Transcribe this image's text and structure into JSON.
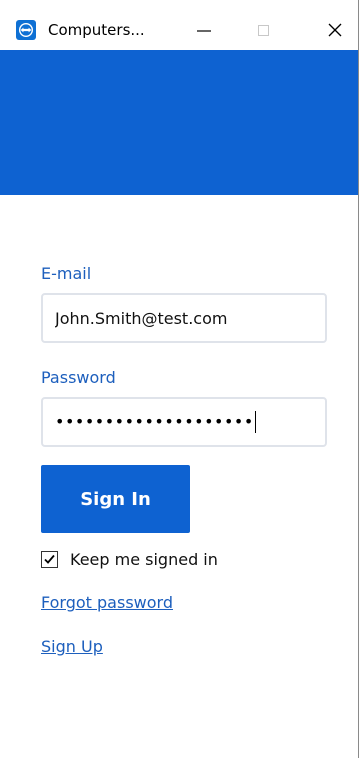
{
  "window": {
    "title": "Computers...",
    "controls": {
      "minimize_icon": "minimize-icon",
      "maximize_icon": "maximize-icon",
      "close_icon": "close-icon"
    }
  },
  "form": {
    "email_label": "E-mail",
    "email_value": "John.Smith@test.com",
    "password_label": "Password",
    "password_mask": "••••••••••••••••••••",
    "sign_in_label": "Sign In",
    "keep_signed_in_label": "Keep me signed in",
    "keep_signed_in_checked": true,
    "forgot_password_link": "Forgot password",
    "sign_up_link": "Sign Up"
  },
  "colors": {
    "brand_blue": "#0e62d1",
    "link_blue": "#1d5fbd",
    "input_border": "#dfe3ea"
  }
}
